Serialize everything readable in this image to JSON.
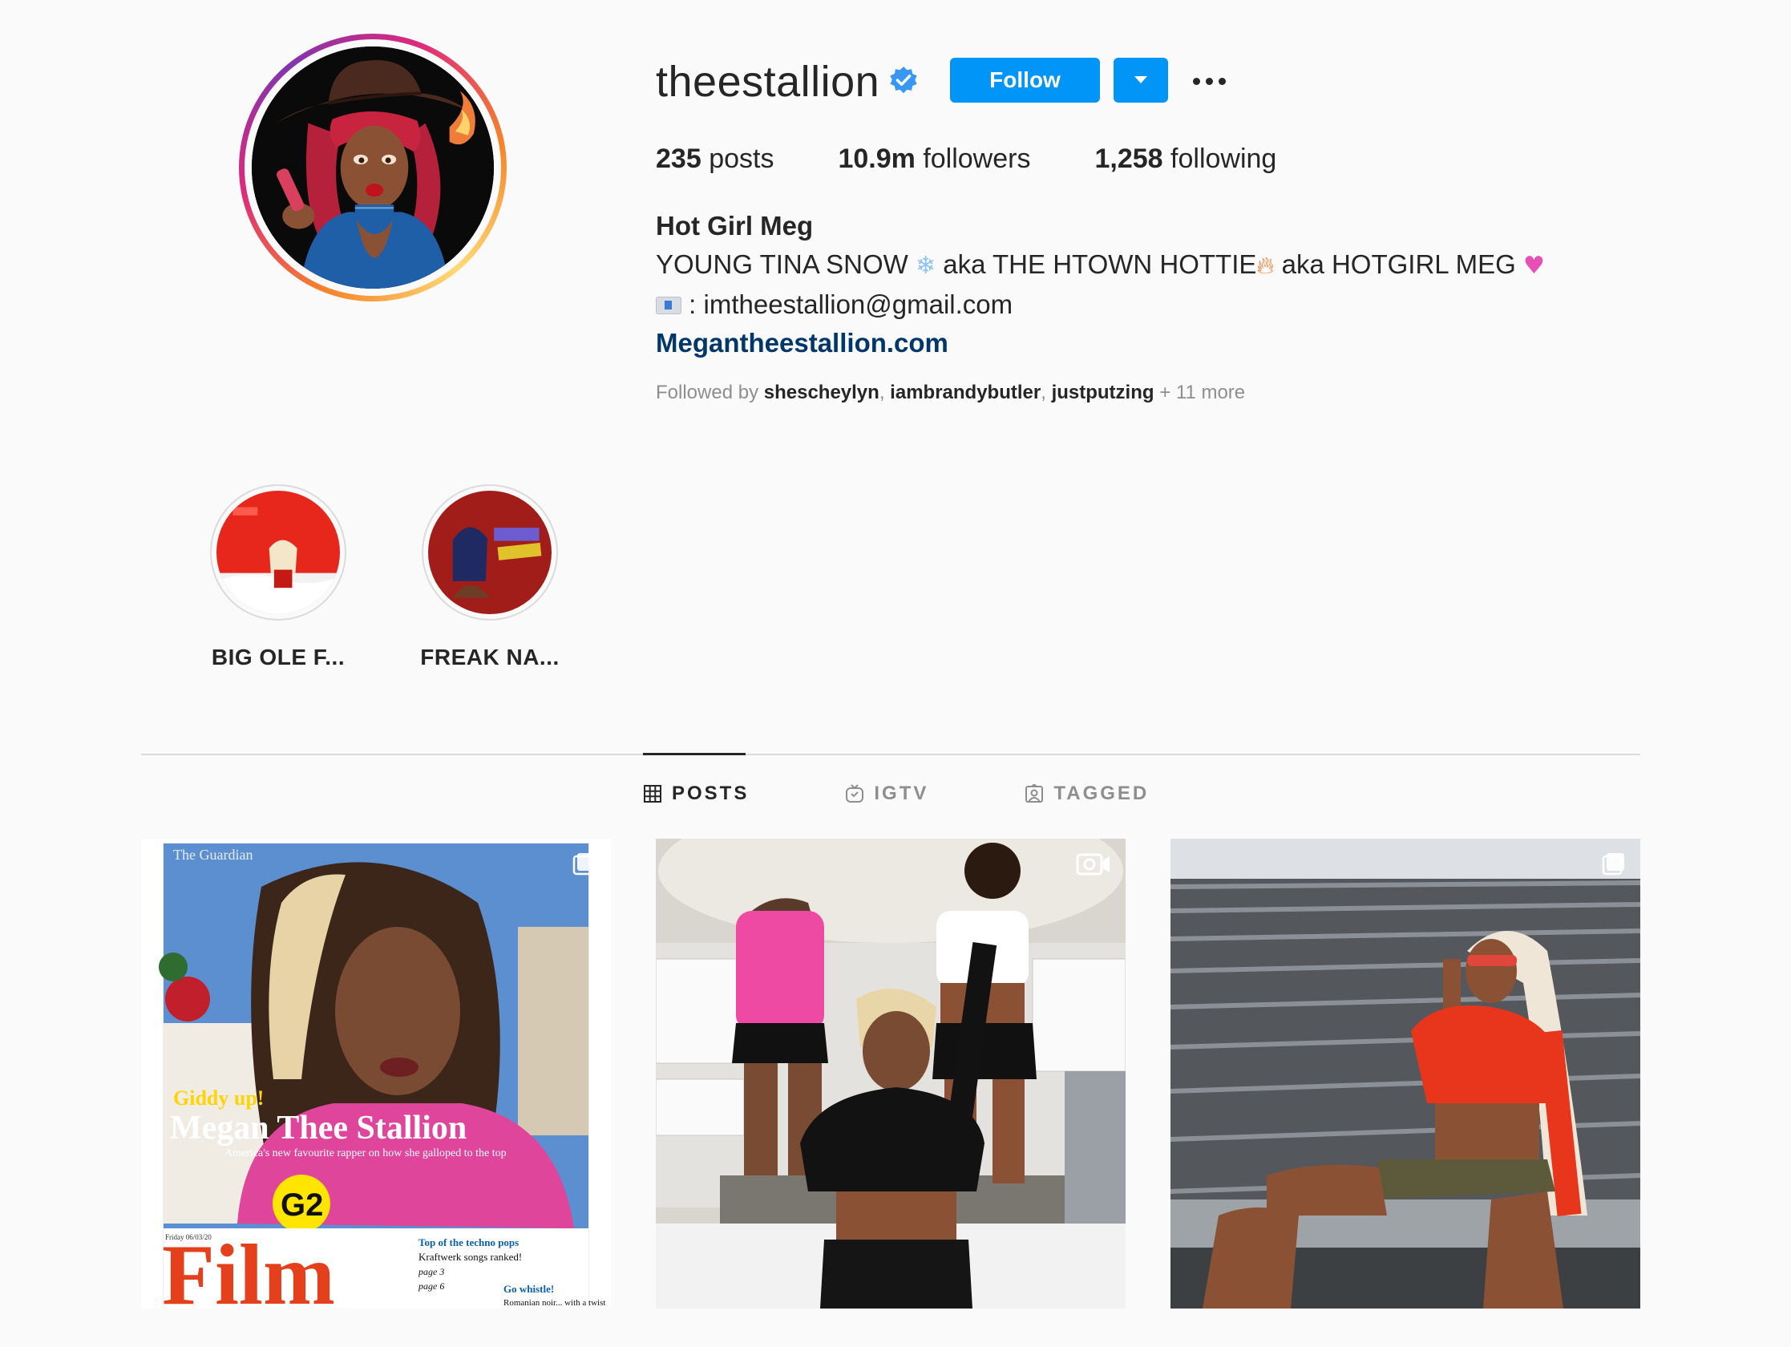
{
  "profile": {
    "username": "theestallion",
    "follow_label": "Follow",
    "stats": {
      "posts_count": "235",
      "posts_label": "posts",
      "followers_count": "10.9m",
      "followers_label": "followers",
      "following_count": "1,258",
      "following_label": "following"
    },
    "full_name": "Hot Girl Meg",
    "bio": {
      "line1_part1": "YOUNG TINA SNOW ",
      "line1_part2": " aka THE HTOWN HOTTIE",
      "line1_part3": " aka HOTGIRL MEG ",
      "line2": " : imtheestallion@gmail.com",
      "link": "Megantheestallion.com"
    },
    "followed_by": {
      "prefix": "Followed by ",
      "accounts": [
        "shescheylyn",
        "iambrandybutler",
        "justputzing"
      ],
      "more": " + 11 more"
    }
  },
  "highlights": [
    {
      "label": "BIG OLE F..."
    },
    {
      "label": "FREAK NA..."
    }
  ],
  "tabs": [
    {
      "label": "POSTS",
      "icon": "grid-icon",
      "active": true
    },
    {
      "label": "IGTV",
      "icon": "igtv-icon",
      "active": false
    },
    {
      "label": "TAGGED",
      "icon": "tagged-icon",
      "active": false
    }
  ],
  "posts": [
    {
      "type": "carousel",
      "cover_text": {
        "masthead": "The Guardian",
        "kicker": "Giddy up!",
        "headline": "Megan Thee Stallion",
        "standfirst": "America's new favourite rapper on how she galloped to the top",
        "section": "G2",
        "section_title": "Film",
        "date": "Friday 06/03/20",
        "teaser1_title": "Top of the techno pops",
        "teaser1_body": "Kraftwerk songs ranked!",
        "teaser1_page": "page 3",
        "teaser2_title": "Go whistle!",
        "teaser2_body": "Romanian noir... with a twist",
        "teaser2_page": "page 6"
      }
    },
    {
      "type": "video"
    },
    {
      "type": "carousel"
    }
  ],
  "colors": {
    "follow_blue": "#0095f6",
    "link_blue": "#00376b",
    "verified_blue": "#3897f0",
    "text_primary": "#262626",
    "text_secondary": "#8e8e8e"
  },
  "icons": {
    "verified": "verified-badge-icon",
    "more": "more-options-icon",
    "dropdown": "chevron-down-icon",
    "carousel": "carousel-icon",
    "video": "video-camera-icon"
  }
}
